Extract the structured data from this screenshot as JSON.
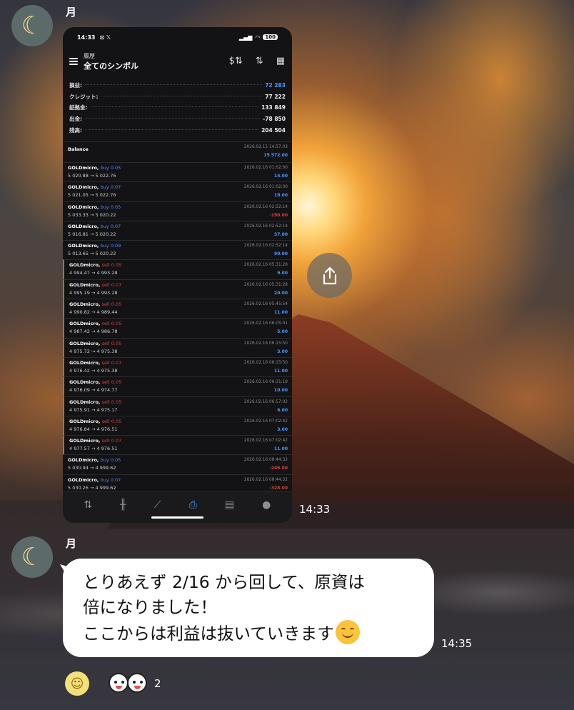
{
  "chat": {
    "sender_name": "月",
    "avatar_icon": "crescent-moon-icon",
    "messages": [
      {
        "type": "image",
        "time": "14:33"
      },
      {
        "type": "text",
        "time": "14:35",
        "lines": [
          "とりあえず 2/16 から回して、原資は",
          "倍になりました！",
          "ここからは利益は抜いていきます"
        ]
      }
    ],
    "share_icon": "share-icon",
    "reaction_add_icon": "smile-icon",
    "reaction_count": "2"
  },
  "screenshot": {
    "status": {
      "time": "14:33",
      "left_icons": "⊠ 𝕏",
      "battery": "100"
    },
    "header": {
      "subtitle": "履歴",
      "title": "全てのシンボル"
    },
    "summary": [
      {
        "label": "損益:",
        "value": "72 283",
        "color": "#4a9bff"
      },
      {
        "label": "クレジット:",
        "value": "77 222"
      },
      {
        "label": "証拠金:",
        "value": "133 849"
      },
      {
        "label": "出金:",
        "value": "-78 850"
      },
      {
        "label": "残高:",
        "value": "204 504"
      }
    ],
    "balance": {
      "label": "Balance",
      "datetime": "2026.02.15 14:57:03",
      "amount": "15 572.00"
    },
    "deals": [
      {
        "symbol": "GOLDmicro,",
        "dir": "buy 0.05",
        "prices": "5 020.88 → 5 022.76",
        "datetime": "2026.02.16 01:02:00",
        "pl": "14.00"
      },
      {
        "symbol": "GOLDmicro,",
        "dir": "buy 0.07",
        "prices": "5 021.05 → 5 022.76",
        "datetime": "2026.02.16 01:02:00",
        "pl": "18.00"
      },
      {
        "symbol": "GOLDmicro,",
        "dir": "buy 0.05",
        "prices": "5 033.33 → 5 020.22",
        "datetime": "2026.02.16 02:52:14",
        "pl": "-190.00"
      },
      {
        "symbol": "GOLDmicro,",
        "dir": "buy 0.07",
        "prices": "5 016.81 → 5 020.22",
        "datetime": "2026.02.16 02:52:14",
        "pl": "37.00"
      },
      {
        "symbol": "GOLDmicro,",
        "dir": "buy 0.09",
        "prices": "5 013.65 → 5 020.22",
        "datetime": "2026.02.16 02:52:14",
        "pl": "90.00"
      },
      {
        "symbol": "GOLDmicro,",
        "dir": "sell 0.05",
        "prices": "4 994.47 → 4 993.28",
        "datetime": "2026.02.16 05:31:28",
        "pl": "9.00"
      },
      {
        "symbol": "GOLDmicro,",
        "dir": "sell 0.07",
        "prices": "4 995.19 → 4 993.28",
        "datetime": "2026.02.16 05:31:28",
        "pl": "20.00"
      },
      {
        "symbol": "GOLDmicro,",
        "dir": "sell 0.05",
        "prices": "4 990.82 → 4 989.44",
        "datetime": "2026.02.16 05:45:54",
        "pl": "11.00"
      },
      {
        "symbol": "GOLDmicro,",
        "dir": "sell 0.05",
        "prices": "4 987.42 → 4 986.78",
        "datetime": "2026.02.16 06:05:01",
        "pl": "5.00"
      },
      {
        "symbol": "GOLDmicro,",
        "dir": "sell 0.05",
        "prices": "4 975.72 → 4 975.38",
        "datetime": "2026.02.16 06:15:50",
        "pl": "3.00"
      },
      {
        "symbol": "GOLDmicro,",
        "dir": "sell 0.07",
        "prices": "4 976.42 → 4 975.38",
        "datetime": "2026.02.16 06:15:50",
        "pl": "11.00"
      },
      {
        "symbol": "GOLDmicro,",
        "dir": "sell 0.05",
        "prices": "4 976.09 → 4 974.77",
        "datetime": "2026.02.16 06:31:19",
        "pl": "10.00"
      },
      {
        "symbol": "GOLDmicro,",
        "dir": "sell 0.05",
        "prices": "4 975.91 → 4 975.17",
        "datetime": "2026.02.16 06:57:02",
        "pl": "6.00"
      },
      {
        "symbol": "GOLDmicro,",
        "dir": "sell 0.05",
        "prices": "4 976.84 → 4 976.51",
        "datetime": "2026.02.16 07:02:42",
        "pl": "3.00"
      },
      {
        "symbol": "GOLDmicro,",
        "dir": "sell 0.07",
        "prices": "4 977.57 → 4 976.51",
        "datetime": "2026.02.16 07:02:42",
        "pl": "11.00"
      },
      {
        "symbol": "GOLDmicro,",
        "dir": "buy 0.05",
        "prices": "5 030.94 → 4 999.62",
        "datetime": "2026.02.16 08:44:32",
        "pl": "-249.00"
      },
      {
        "symbol": "GOLDmicro,",
        "dir": "buy 0.07",
        "prices": "5 030.26 → 4 999.62",
        "datetime": "2026.02.16 08:44:32",
        "pl": "-328.00"
      }
    ],
    "tabbar": [
      "quotes-icon",
      "chart-icon",
      "trade-icon",
      "history-icon",
      "news-icon",
      "chat-icon"
    ],
    "active_tab": "history-icon"
  },
  "colors": {
    "buy": "#4a8cff",
    "sell": "#e0403a",
    "profit": "#4a9bff",
    "loss": "#e0403a",
    "bubble": "#ffffff"
  }
}
